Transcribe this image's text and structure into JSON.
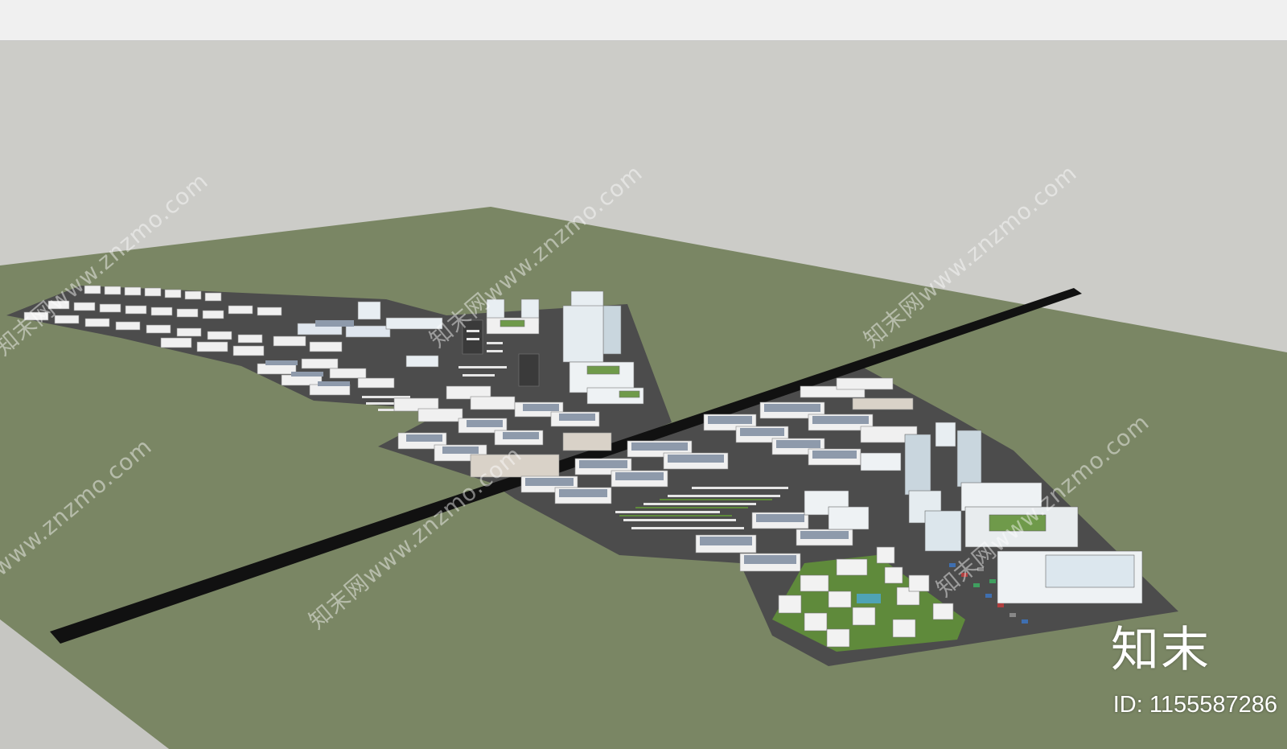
{
  "scene": {
    "colors": {
      "sky": "#ccccc8",
      "ground": "#7a8664",
      "site_pavement": "#4c4c4c",
      "road": "#111111",
      "building_roof": "#f2f2f2",
      "solar_roof": "#9aa7b8",
      "green_roof": "#6f9a4a",
      "glass": "#b9d3e0"
    },
    "districts": [
      "west-industrial-strip",
      "central-office-park",
      "south-industrial-block",
      "east-residential-commercial"
    ]
  },
  "watermarks": [
    {
      "text": "知末网www.znzmo.com"
    },
    {
      "text": "知末网www.znzmo.com"
    },
    {
      "text": "知末网www.znzmo.com"
    },
    {
      "text": "知末网www.znzmo.com"
    },
    {
      "text": "知末网www.znzmo.com"
    },
    {
      "text": "知末网www.znzmo.com"
    }
  ],
  "brand": {
    "logo_text": "知末",
    "id_text": "ID: 1155587286"
  }
}
